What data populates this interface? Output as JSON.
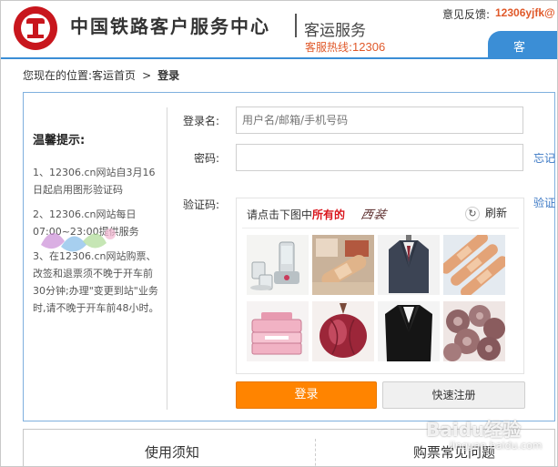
{
  "header": {
    "brand_title": "中国铁路客户服务中心",
    "brand_sub": "客运服务",
    "hotline_label": "客服热线:",
    "hotline_number": "12306",
    "feedback_label": "意见反馈:",
    "feedback_email": "12306yjfk@",
    "nav_tab": "客"
  },
  "breadcrumb": {
    "prefix": "您现在的位置:",
    "home": "客运首页",
    "separator": ">",
    "current": "登录"
  },
  "tips": {
    "title": "温馨提示:",
    "items": [
      "1、12306.cn网站自3月16日起启用图形验证码",
      "2、12306.cn网站每日07:00~23:00提供服务",
      "3、在12306.cn网站购票、改签和退票须不晚于开车前30分钟;办理\"变更到站\"业务时,请不晚于开车前48小时。"
    ]
  },
  "form": {
    "username_label": "登录名:",
    "username_placeholder": "用户名/邮箱/手机号码",
    "password_label": "密码:",
    "password_value": "",
    "forgot_link": "忘记",
    "captcha_label": "验证码:",
    "captcha_side_link": "验证"
  },
  "captcha": {
    "prompt_prefix": "请点击下图中",
    "prompt_highlight": "所有的",
    "prompt_word": "西装",
    "refresh_label": "刷新",
    "images": [
      "juicer",
      "bandage",
      "suit",
      "bandages",
      "lunchbox",
      "onion",
      "jacket",
      "mushrooms"
    ]
  },
  "buttons": {
    "login": "登录",
    "register": "快速注册"
  },
  "bottom": {
    "tab_left": "使用须知",
    "tab_right": "购票常见问题"
  },
  "watermarks": {
    "baidu": "Baidu经验",
    "baidu_sub": "jingyan.baidu.com"
  },
  "colors": {
    "accent_blue": "#3b8ed6",
    "brand_red": "#c8161d",
    "login_orange": "#ff8400",
    "hotline_orange": "#e0592a"
  }
}
